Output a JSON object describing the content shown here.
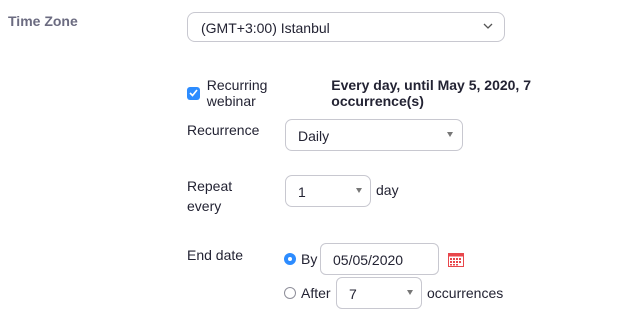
{
  "time_zone": {
    "label": "Time Zone",
    "selected": "(GMT+3:00) Istanbul"
  },
  "recurring": {
    "checked": true,
    "label": "Recurring webinar",
    "summary": "Every day, until May 5, 2020, 7 occurrence(s)"
  },
  "recurrence": {
    "label": "Recurrence",
    "selected": "Daily"
  },
  "repeat_every": {
    "label_line1": "Repeat",
    "label_line2": "every",
    "selected": "1",
    "unit": "day"
  },
  "end_date": {
    "label": "End date",
    "by_label": "By",
    "by_selected": true,
    "date_value": "05/05/2020",
    "after_label": "After",
    "after_value": "7",
    "after_unit": "occurrences"
  },
  "colors": {
    "accent": "#2d8cff",
    "calendar_icon": "#e8474c",
    "label_gray": "#6b6b80",
    "border": "#c8c8d0"
  }
}
